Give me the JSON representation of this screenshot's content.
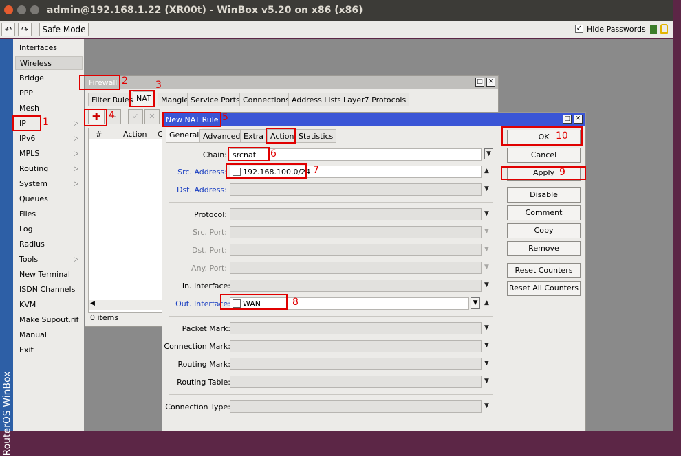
{
  "window": {
    "title": "admin@192.168.1.22 (XR00t) - WinBox v5.20 on x86 (x86)"
  },
  "toolbar": {
    "undo_icon": "undo-icon",
    "redo_icon": "redo-icon",
    "safe_mode": "Safe Mode",
    "hide_passwords": "Hide Passwords",
    "hide_passwords_checked": true
  },
  "sidebar": {
    "vertical_label": "RouterOS WinBox",
    "items": [
      {
        "label": "Interfaces"
      },
      {
        "label": "Wireless"
      },
      {
        "label": "Bridge"
      },
      {
        "label": "PPP"
      },
      {
        "label": "Mesh"
      },
      {
        "label": "IP",
        "arrow": "▷"
      },
      {
        "label": "IPv6",
        "arrow": "▷"
      },
      {
        "label": "MPLS",
        "arrow": "▷"
      },
      {
        "label": "Routing",
        "arrow": "▷"
      },
      {
        "label": "System",
        "arrow": "▷"
      },
      {
        "label": "Queues"
      },
      {
        "label": "Files"
      },
      {
        "label": "Log"
      },
      {
        "label": "Radius"
      },
      {
        "label": "Tools",
        "arrow": "▷"
      },
      {
        "label": "New Terminal"
      },
      {
        "label": "ISDN Channels"
      },
      {
        "label": "KVM"
      },
      {
        "label": "Make Supout.rif"
      },
      {
        "label": "Manual"
      },
      {
        "label": "Exit"
      }
    ]
  },
  "firewall": {
    "title": "Firewall",
    "tabs": [
      "Filter Rules",
      "NAT",
      "Mangle",
      "Service Ports",
      "Connections",
      "Address Lists",
      "Layer7 Protocols"
    ],
    "columns": [
      "#",
      "Action",
      "C"
    ],
    "status": "0 items"
  },
  "nat_rule": {
    "title": "New NAT Rule",
    "tabs": [
      "General",
      "Advanced",
      "Extra",
      "Action",
      "Statistics"
    ],
    "chain": {
      "label": "Chain:",
      "value": "srcnat"
    },
    "src_address": {
      "label": "Src. Address:",
      "value": "192.168.100.0/24"
    },
    "dst_address": {
      "label": "Dst. Address:"
    },
    "protocol": {
      "label": "Protocol:"
    },
    "src_port": {
      "label": "Src. Port:"
    },
    "dst_port": {
      "label": "Dst. Port:"
    },
    "any_port": {
      "label": "Any. Port:"
    },
    "in_interface": {
      "label": "In. Interface:"
    },
    "out_interface": {
      "label": "Out. Interface:",
      "value": "WAN"
    },
    "packet_mark": {
      "label": "Packet Mark:"
    },
    "connection_mark": {
      "label": "Connection Mark:"
    },
    "routing_mark": {
      "label": "Routing Mark:"
    },
    "routing_table": {
      "label": "Routing Table:"
    },
    "connection_type": {
      "label": "Connection Type:"
    },
    "buttons": [
      "OK",
      "Cancel",
      "Apply",
      "Disable",
      "Comment",
      "Copy",
      "Remove",
      "Reset Counters",
      "Reset All Counters"
    ]
  },
  "annotations": [
    "1",
    "2",
    "3",
    "4",
    "5",
    "6",
    "7",
    "8",
    "9",
    "10"
  ],
  "colors": {
    "accent_blue": "#2d5fa6",
    "highlight_red": "#e00000",
    "active_title": "#3a55d6"
  }
}
